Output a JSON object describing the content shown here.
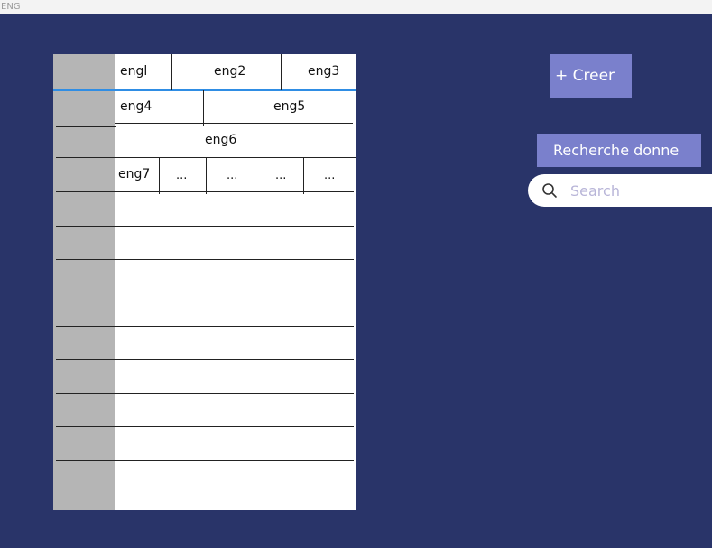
{
  "topbar": {
    "label": "ENG"
  },
  "table": {
    "header": [
      "engl",
      "eng2",
      "eng3"
    ],
    "row2": [
      "eng4",
      "eng5"
    ],
    "row3": [
      "eng6"
    ],
    "row4": [
      "eng7",
      "...",
      "...",
      "...",
      "..."
    ]
  },
  "actions": {
    "create_label": "+ Creer",
    "search_data_label": "Recherche donne"
  },
  "search": {
    "placeholder": "Search"
  },
  "colors": {
    "background": "#293469",
    "button": "#7a80cc",
    "accent": "#2f8de4",
    "gutter": "#b5b5b5"
  }
}
